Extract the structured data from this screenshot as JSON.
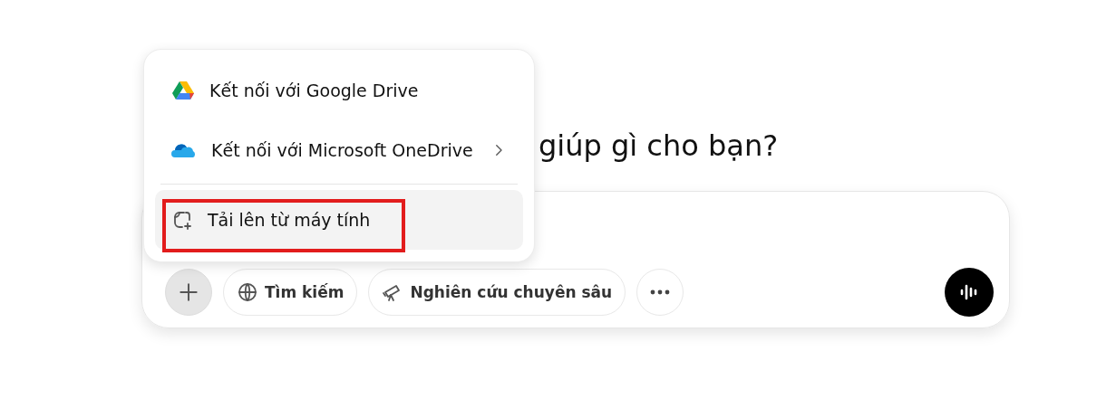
{
  "heading": "giúp gì cho bạn?",
  "menu": {
    "items": [
      {
        "kind": "gdrive",
        "label": "Kết nối với Google Drive",
        "submenu": false,
        "hovered": false,
        "annotated": false
      },
      {
        "kind": "onedrive",
        "label": "Kết nối với Microsoft OneDrive",
        "submenu": true,
        "hovered": false,
        "annotated": false
      },
      {
        "kind": "upload",
        "label": "Tải lên từ máy tính",
        "submenu": false,
        "hovered": true,
        "annotated": true
      }
    ]
  },
  "toolbar": {
    "tools": [
      {
        "kind": "search",
        "label": "Tìm kiếm"
      },
      {
        "kind": "research",
        "label": "Nghiên cứu chuyên sâu"
      }
    ]
  }
}
